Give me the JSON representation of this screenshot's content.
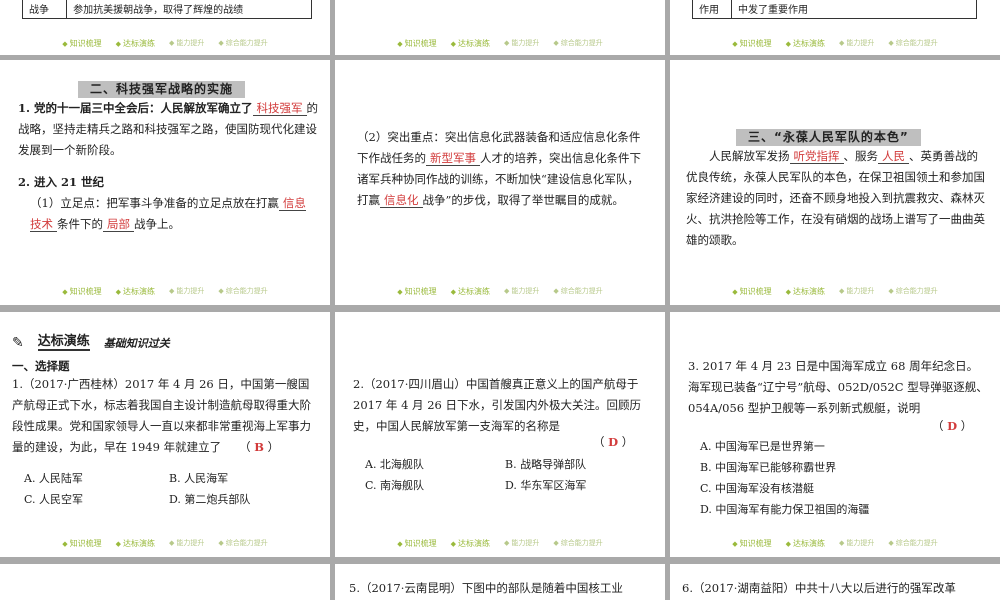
{
  "footer": {
    "a": "知识梳理",
    "b": "达标演练",
    "c": "能力提升",
    "d": "综合能力提升"
  },
  "top": {
    "left_cell1": "战争",
    "left_cell2": "参加抗美援朝战争，取得了辉煌的战绩",
    "right_cell1": "作用",
    "right_cell2": "中发了重要作用"
  },
  "p1": {
    "heading": "二、科技强军战略的实施",
    "item1_pre": "1. 党的十一届三中全会后：人民解放军确立了",
    "item1_b1": "科技强军",
    "item1_post": "的战略，坚持走精兵之路和科技强军之路，使国防现代化建设发展到一个新阶段。",
    "item2": "2. 进入 21 世纪",
    "item2_1_pre": "（1）立足点：把军事斗争准备的立足点放在打赢",
    "item2_1_b1": "信息技术",
    "item2_1_mid": "条件下的",
    "item2_1_b2": "局部",
    "item2_1_post": "战争上。"
  },
  "p2": {
    "pre": "（2）突出重点：突出信息化武器装备和适应信息化条件下作战任务的",
    "b1": "新型军事",
    "mid1": "人才的培养，突出信息化条件下诸军兵种协同作战的训练，不断加快“建设信息化军队，打赢",
    "b2": "信息化",
    "post": "战争”的步伐，取得了举世瞩目的成就。"
  },
  "p3": {
    "heading": "三、“永葆人民军队的本色”",
    "pre": "人民解放军发扬",
    "b1": "听党指挥",
    "mid1": "、服务",
    "b2": "人民",
    "post": "、英勇善战的优良传统，永葆人民军队的本色，在保卫祖国领土和参加国家经济建设的同时，还奋不顾身地投入到抗震救灾、森林灭火、抗洪抢险等工作，在没有硝烟的战场上谱写了一曲曲英雄的颂歌。"
  },
  "p4": {
    "badge": "达标演练",
    "sub": "基础知识过关",
    "section": "一、选择题",
    "q": "1.（2017·广西桂林）2017 年 4 月 26 日，中国第一艘国产航母正式下水，标志着我国自主设计制造航母取得重大阶段性成果。党和国家领导人一直以来都非常重视海上军事力量的建设，为此，早在 1949 年就建立了",
    "answer": "B",
    "options": [
      "A. 人民陆军",
      "B. 人民海军",
      "C. 人民空军",
      "D. 第二炮兵部队"
    ]
  },
  "p5": {
    "q": "2.（2017·四川眉山）中国首艘真正意义上的国产航母于 2017 年 4 月 26 日下水，引发国内外极大关注。回顾历史，中国人民解放军第一支海军的名称是",
    "answer": "D",
    "options": [
      "A. 北海舰队",
      "B. 战略导弹部队",
      "C. 南海舰队",
      "D. 华东军区海军"
    ]
  },
  "p6": {
    "q": "3. 2017 年 4 月 23 日是中国海军成立 68 周年纪念日。海军现已装备“辽宁号”航母、052D/052C 型导弹驱逐舰、054A/056 型护卫舰等一系列新式舰艇，说明",
    "answer": "D",
    "options": [
      "A. 中国海军已是世界第一",
      "B. 中国海军已能够称霸世界",
      "C. 中国海军没有核潜艇",
      "D. 中国海军有能力保卫祖国的海疆"
    ]
  },
  "bottom": {
    "mid": "5.（2017·云南昆明）下图中的部队是随着中国核工业",
    "right": "6.（2017·湖南益阳）中共十八大以后进行的强军改革"
  }
}
